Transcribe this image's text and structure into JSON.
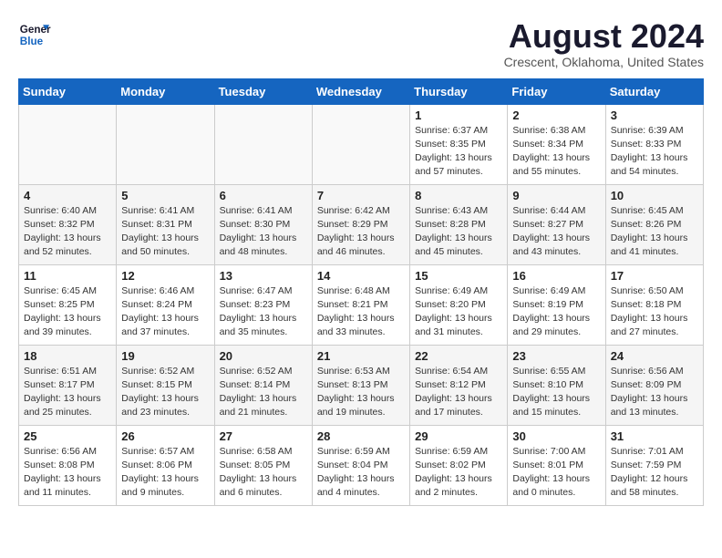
{
  "logo": {
    "line1": "General",
    "line2": "Blue"
  },
  "title": "August 2024",
  "location": "Crescent, Oklahoma, United States",
  "days_of_week": [
    "Sunday",
    "Monday",
    "Tuesday",
    "Wednesday",
    "Thursday",
    "Friday",
    "Saturday"
  ],
  "weeks": [
    [
      {
        "day": "",
        "info": ""
      },
      {
        "day": "",
        "info": ""
      },
      {
        "day": "",
        "info": ""
      },
      {
        "day": "",
        "info": ""
      },
      {
        "day": "1",
        "info": "Sunrise: 6:37 AM\nSunset: 8:35 PM\nDaylight: 13 hours\nand 57 minutes."
      },
      {
        "day": "2",
        "info": "Sunrise: 6:38 AM\nSunset: 8:34 PM\nDaylight: 13 hours\nand 55 minutes."
      },
      {
        "day": "3",
        "info": "Sunrise: 6:39 AM\nSunset: 8:33 PM\nDaylight: 13 hours\nand 54 minutes."
      }
    ],
    [
      {
        "day": "4",
        "info": "Sunrise: 6:40 AM\nSunset: 8:32 PM\nDaylight: 13 hours\nand 52 minutes."
      },
      {
        "day": "5",
        "info": "Sunrise: 6:41 AM\nSunset: 8:31 PM\nDaylight: 13 hours\nand 50 minutes."
      },
      {
        "day": "6",
        "info": "Sunrise: 6:41 AM\nSunset: 8:30 PM\nDaylight: 13 hours\nand 48 minutes."
      },
      {
        "day": "7",
        "info": "Sunrise: 6:42 AM\nSunset: 8:29 PM\nDaylight: 13 hours\nand 46 minutes."
      },
      {
        "day": "8",
        "info": "Sunrise: 6:43 AM\nSunset: 8:28 PM\nDaylight: 13 hours\nand 45 minutes."
      },
      {
        "day": "9",
        "info": "Sunrise: 6:44 AM\nSunset: 8:27 PM\nDaylight: 13 hours\nand 43 minutes."
      },
      {
        "day": "10",
        "info": "Sunrise: 6:45 AM\nSunset: 8:26 PM\nDaylight: 13 hours\nand 41 minutes."
      }
    ],
    [
      {
        "day": "11",
        "info": "Sunrise: 6:45 AM\nSunset: 8:25 PM\nDaylight: 13 hours\nand 39 minutes."
      },
      {
        "day": "12",
        "info": "Sunrise: 6:46 AM\nSunset: 8:24 PM\nDaylight: 13 hours\nand 37 minutes."
      },
      {
        "day": "13",
        "info": "Sunrise: 6:47 AM\nSunset: 8:23 PM\nDaylight: 13 hours\nand 35 minutes."
      },
      {
        "day": "14",
        "info": "Sunrise: 6:48 AM\nSunset: 8:21 PM\nDaylight: 13 hours\nand 33 minutes."
      },
      {
        "day": "15",
        "info": "Sunrise: 6:49 AM\nSunset: 8:20 PM\nDaylight: 13 hours\nand 31 minutes."
      },
      {
        "day": "16",
        "info": "Sunrise: 6:49 AM\nSunset: 8:19 PM\nDaylight: 13 hours\nand 29 minutes."
      },
      {
        "day": "17",
        "info": "Sunrise: 6:50 AM\nSunset: 8:18 PM\nDaylight: 13 hours\nand 27 minutes."
      }
    ],
    [
      {
        "day": "18",
        "info": "Sunrise: 6:51 AM\nSunset: 8:17 PM\nDaylight: 13 hours\nand 25 minutes."
      },
      {
        "day": "19",
        "info": "Sunrise: 6:52 AM\nSunset: 8:15 PM\nDaylight: 13 hours\nand 23 minutes."
      },
      {
        "day": "20",
        "info": "Sunrise: 6:52 AM\nSunset: 8:14 PM\nDaylight: 13 hours\nand 21 minutes."
      },
      {
        "day": "21",
        "info": "Sunrise: 6:53 AM\nSunset: 8:13 PM\nDaylight: 13 hours\nand 19 minutes."
      },
      {
        "day": "22",
        "info": "Sunrise: 6:54 AM\nSunset: 8:12 PM\nDaylight: 13 hours\nand 17 minutes."
      },
      {
        "day": "23",
        "info": "Sunrise: 6:55 AM\nSunset: 8:10 PM\nDaylight: 13 hours\nand 15 minutes."
      },
      {
        "day": "24",
        "info": "Sunrise: 6:56 AM\nSunset: 8:09 PM\nDaylight: 13 hours\nand 13 minutes."
      }
    ],
    [
      {
        "day": "25",
        "info": "Sunrise: 6:56 AM\nSunset: 8:08 PM\nDaylight: 13 hours\nand 11 minutes."
      },
      {
        "day": "26",
        "info": "Sunrise: 6:57 AM\nSunset: 8:06 PM\nDaylight: 13 hours\nand 9 minutes."
      },
      {
        "day": "27",
        "info": "Sunrise: 6:58 AM\nSunset: 8:05 PM\nDaylight: 13 hours\nand 6 minutes."
      },
      {
        "day": "28",
        "info": "Sunrise: 6:59 AM\nSunset: 8:04 PM\nDaylight: 13 hours\nand 4 minutes."
      },
      {
        "day": "29",
        "info": "Sunrise: 6:59 AM\nSunset: 8:02 PM\nDaylight: 13 hours\nand 2 minutes."
      },
      {
        "day": "30",
        "info": "Sunrise: 7:00 AM\nSunset: 8:01 PM\nDaylight: 13 hours\nand 0 minutes."
      },
      {
        "day": "31",
        "info": "Sunrise: 7:01 AM\nSunset: 7:59 PM\nDaylight: 12 hours\nand 58 minutes."
      }
    ]
  ]
}
